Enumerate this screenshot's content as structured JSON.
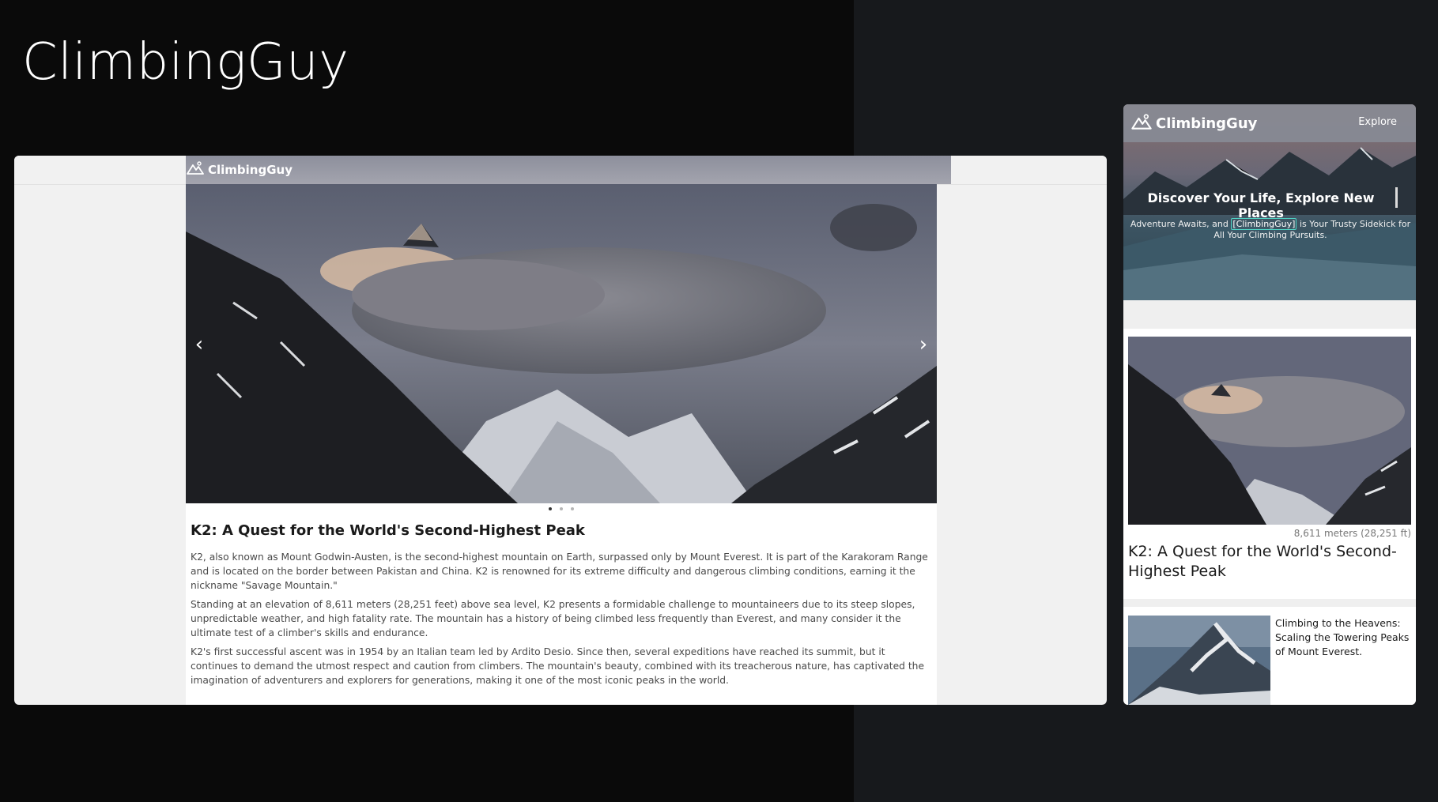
{
  "brand": {
    "title": "ClimbingGuy"
  },
  "desktop": {
    "nav": {
      "logo_text": "ClimbingGuy"
    },
    "carousel": {
      "prev_icon": "chevron-left-icon",
      "next_icon": "chevron-right-icon",
      "slides": 3,
      "active": 1
    },
    "article": {
      "title": "K2: A Quest for the World's Second-Highest Peak",
      "paragraphs": [
        "K2, also known as Mount Godwin-Austen, is the second-highest mountain on Earth, surpassed only by Mount Everest. It is part of the Karakoram Range and is located on the border between Pakistan and China. K2 is renowned for its extreme difficulty and dangerous climbing conditions, earning it the nickname \"Savage Mountain.\"",
        "Standing at an elevation of 8,611 meters (28,251 feet) above sea level, K2 presents a formidable challenge to mountaineers due to its steep slopes, unpredictable weather, and high fatality rate. The mountain has a history of being climbed less frequently than Everest, and many consider it the ultimate test of a climber's skills and endurance.",
        "K2's first successful ascent was in 1954 by an Italian team led by Ardito Desio. Since then, several expeditions have reached its summit, but it continues to demand the utmost respect and caution from climbers. The mountain's beauty, combined with its treacherous nature, has captivated the imagination of adventurers and explorers for generations, making it one of the most iconic peaks in the world."
      ]
    }
  },
  "mobile": {
    "nav": {
      "logo_text": "ClimbingGuy",
      "explore_label": "Explore"
    },
    "hero": {
      "heading": "Discover Your Life, Explore New Places",
      "sub_before": "Adventure Awaits, and ",
      "sub_highlight": "[ClimbingGuy]",
      "sub_after": " is Your Trusty Sidekick for All Your Climbing Pursuits."
    },
    "card1": {
      "meta": "8,611 meters (28,251 ft)",
      "title": "K2: A Quest for the World's Second-Highest Peak"
    },
    "card2": {
      "title": "Climbing to the Heavens: Scaling the Towering Peaks of Mount Everest."
    }
  },
  "colors": {
    "accent_highlight": "#4fd3c4",
    "nav_overlay": "#878c96",
    "page_bg": "#0a0a0a"
  }
}
